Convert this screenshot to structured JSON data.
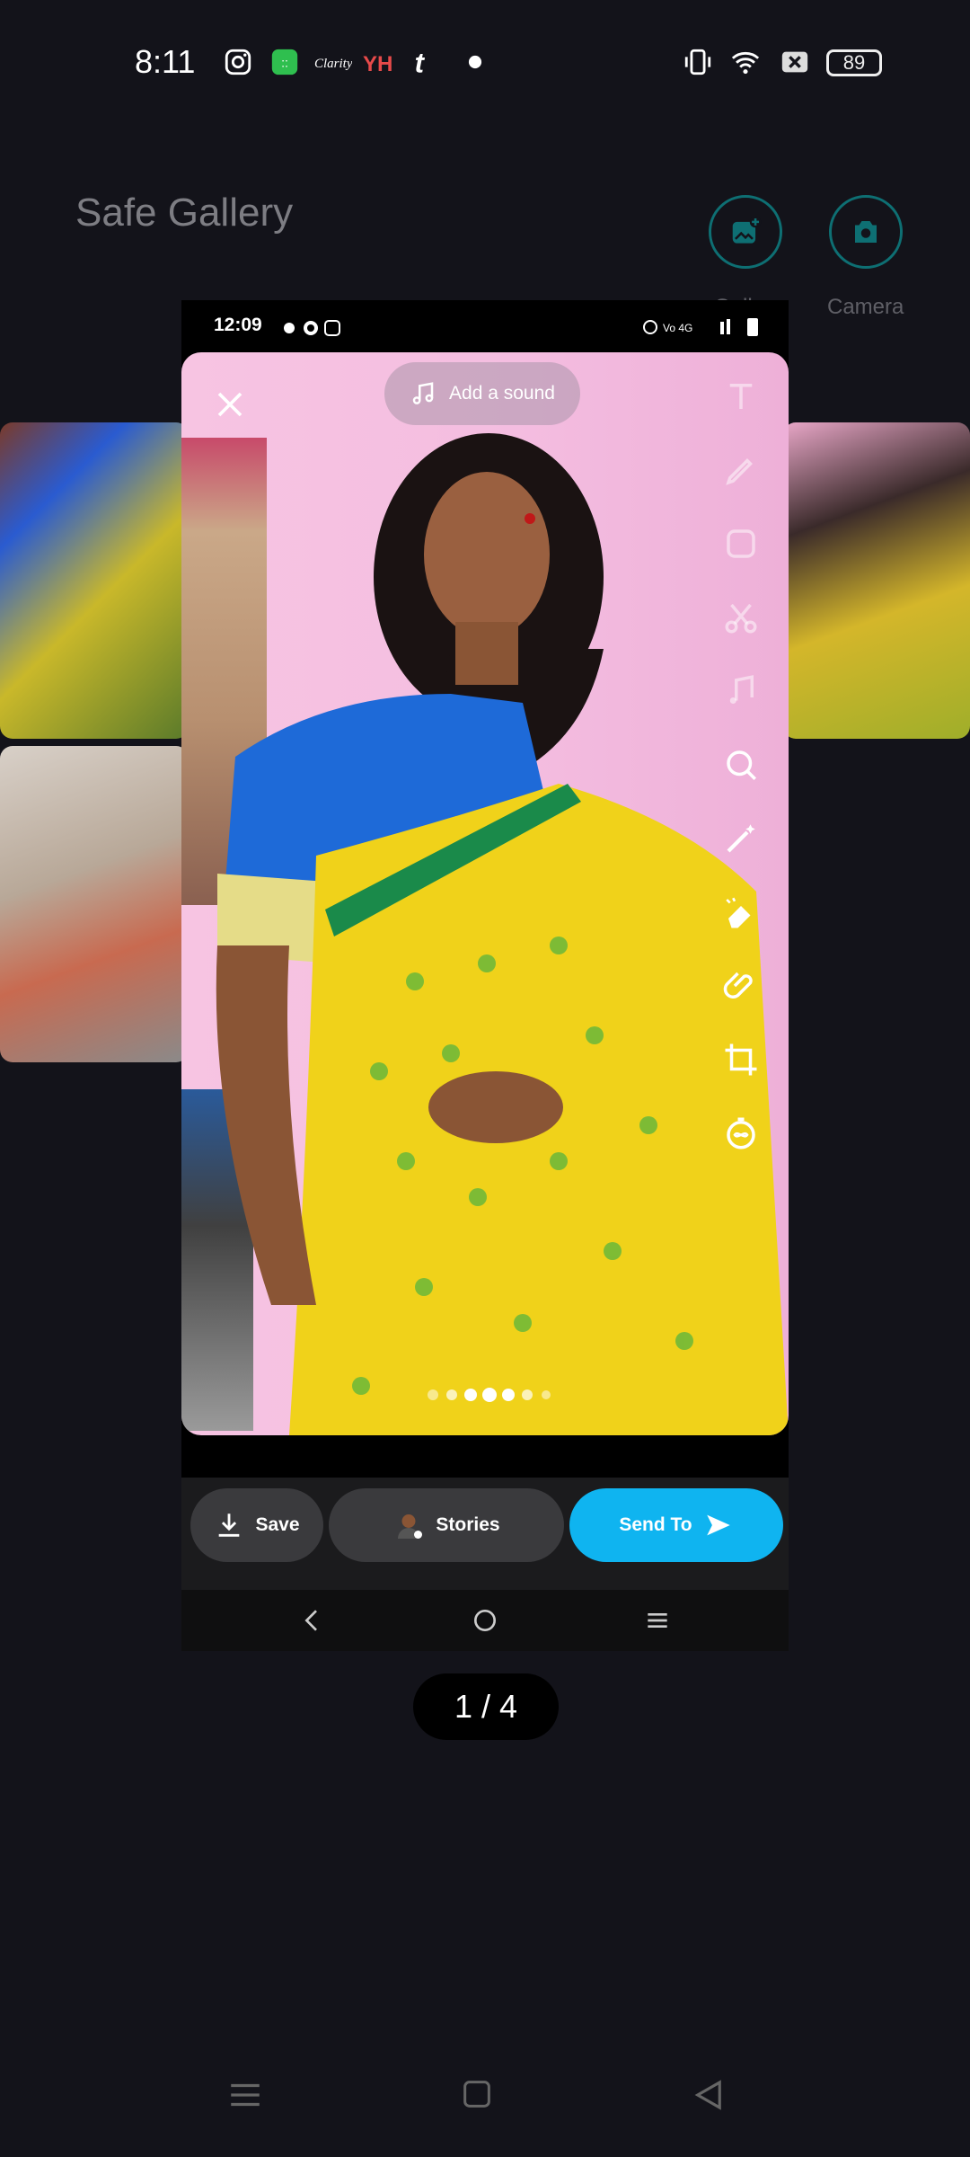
{
  "status_bar": {
    "time": "8:11",
    "battery": "89",
    "notif_icons": [
      "instagram-icon",
      "clock-app-icon",
      "clarity-icon",
      "hotstar-icon",
      "tumblr-icon",
      "dot-icon"
    ],
    "right_icons": [
      "vibrate-icon",
      "wifi-icon",
      "sim-off-icon"
    ]
  },
  "app": {
    "title": "Safe Gallery",
    "actions": [
      {
        "label": "Gallery",
        "icon": "add-photo-icon"
      },
      {
        "label": "Camera",
        "icon": "camera-icon"
      }
    ]
  },
  "viewer": {
    "counter": "1 / 4",
    "screenshot": {
      "status_time": "12:09",
      "sound_label": "Add a sound",
      "buttons": {
        "save": "Save",
        "stories": "Stories",
        "send": "Send To"
      },
      "tools": [
        "text-icon",
        "pencil-icon",
        "sticker-icon",
        "scissors-icon",
        "music-icon",
        "lens-icon",
        "magic-wand-icon",
        "eraser-icon",
        "paperclip-icon",
        "crop-icon",
        "timer-icon"
      ],
      "accent_color": "#0fb4f0"
    }
  },
  "colors": {
    "background": "#13131a",
    "accent": "#0e6f73"
  }
}
